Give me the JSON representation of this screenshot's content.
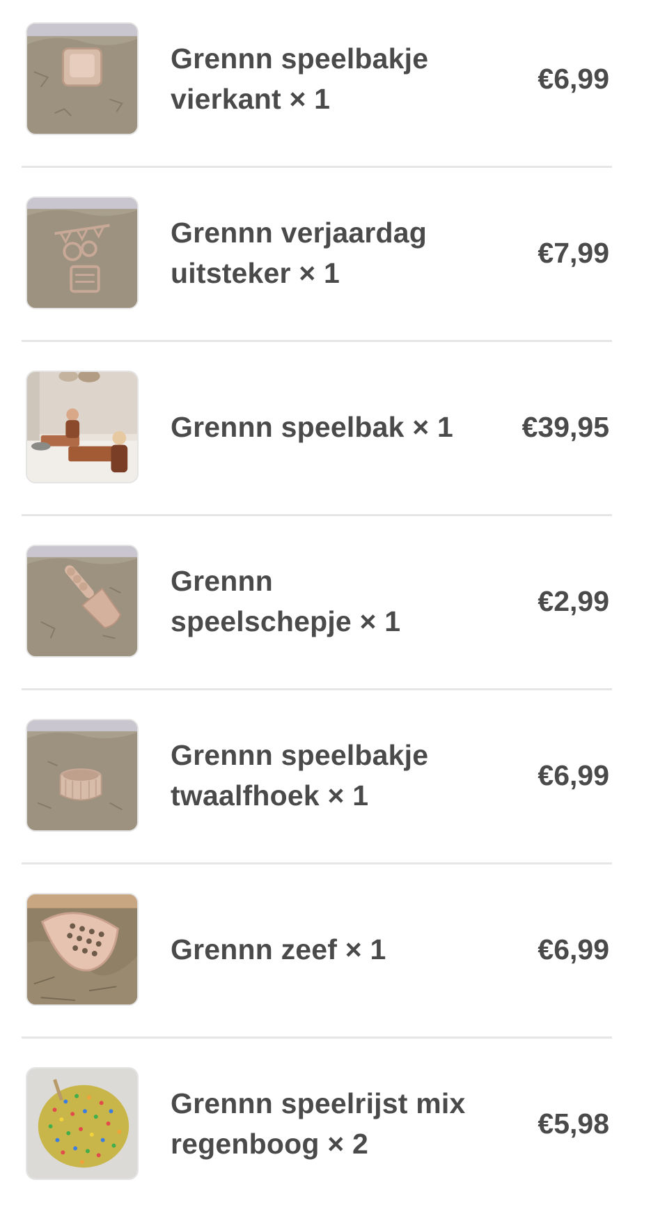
{
  "order_items": [
    {
      "name_line1": "Grennn speelbakje",
      "name_line2": "vierkant × 1",
      "price": "€6,99",
      "thumb_icon": "square-sand-mold-icon"
    },
    {
      "name_line1": "Grennn verjaardag",
      "name_line2": "uitsteker × 1",
      "price": "€7,99",
      "thumb_icon": "birthday-cutter-icon"
    },
    {
      "name_line1": "Grennn speelbak × 1",
      "name_line2": "",
      "price": "€39,95",
      "thumb_icon": "play-tray-photo"
    },
    {
      "name_line1": "Grennn",
      "name_line2": "speelschepje × 1",
      "price": "€2,99",
      "thumb_icon": "scoop-icon"
    },
    {
      "name_line1": "Grennn speelbakje",
      "name_line2": "twaalfhoek × 1",
      "price": "€6,99",
      "thumb_icon": "dodecagon-mold-icon"
    },
    {
      "name_line1": "Grennn zeef × 1",
      "name_line2": "",
      "price": "€6,99",
      "thumb_icon": "sieve-icon"
    },
    {
      "name_line1": "Grennn speelrijst mix",
      "name_line2": "regenboog × 2",
      "price": "€5,98",
      "thumb_icon": "rainbow-rice-icon"
    }
  ],
  "colors": {
    "text": "#4a4a4a",
    "divider": "#e6e6e6",
    "sand": "#a89c88"
  }
}
